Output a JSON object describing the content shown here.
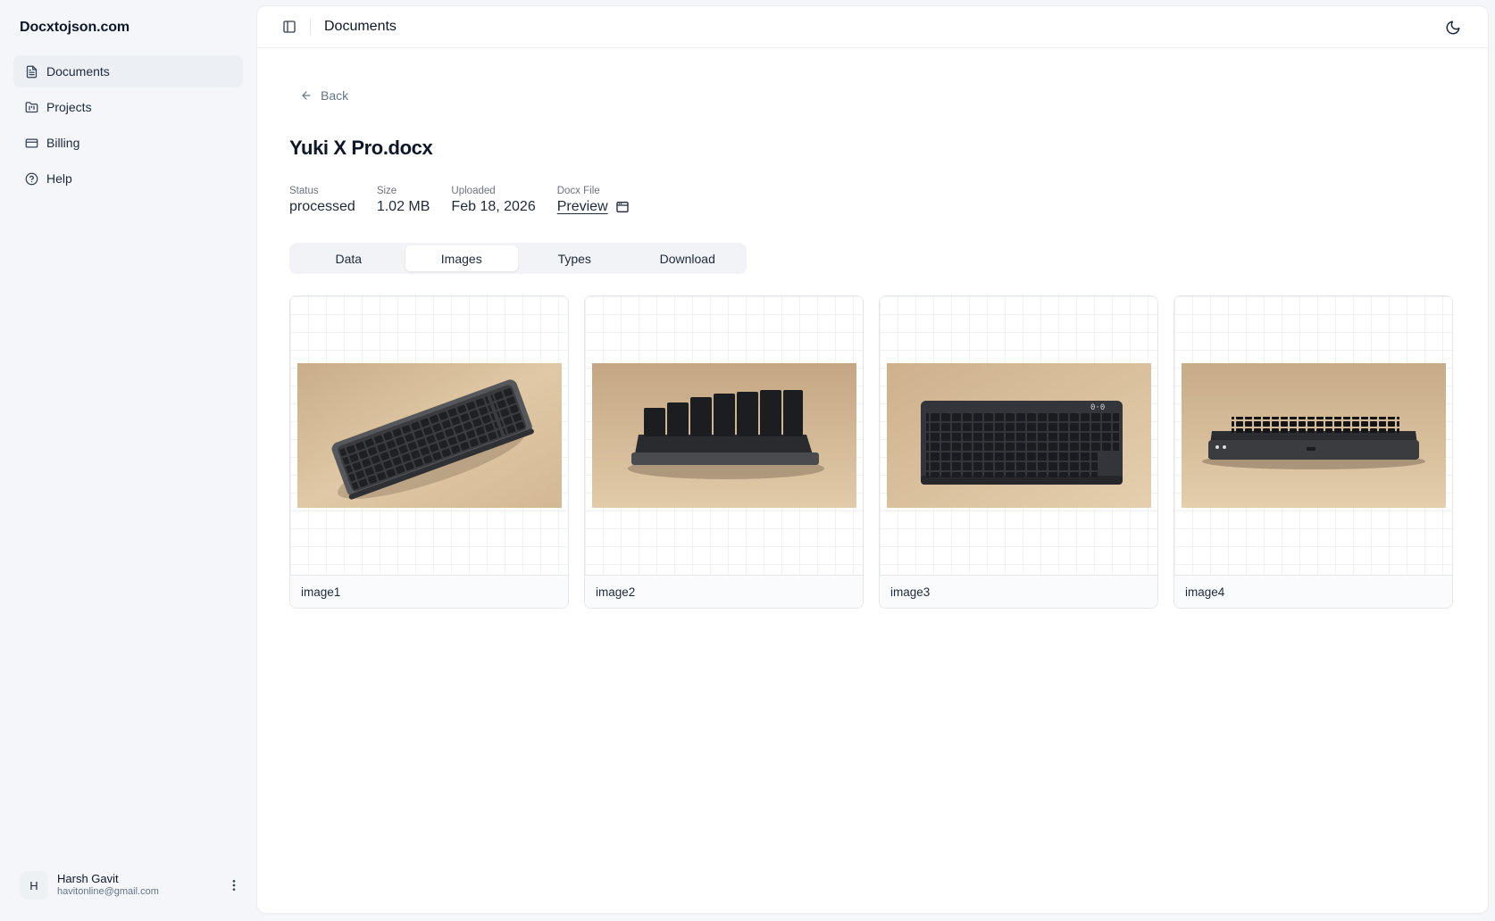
{
  "app": {
    "brand": "Docxtojson.com"
  },
  "sidebar": {
    "items": [
      {
        "label": "Documents",
        "icon": "document-icon",
        "active": true
      },
      {
        "label": "Projects",
        "icon": "folder-icon",
        "active": false
      },
      {
        "label": "Billing",
        "icon": "credit-card-icon",
        "active": false
      },
      {
        "label": "Help",
        "icon": "help-circle-icon",
        "active": false
      }
    ]
  },
  "user": {
    "initial": "H",
    "name": "Harsh Gavit",
    "email": "havitonline@gmail.com"
  },
  "header": {
    "title": "Documents"
  },
  "page": {
    "back_label": "Back",
    "title": "Yuki X Pro.docx",
    "meta": {
      "status_label": "Status",
      "status_value": "processed",
      "size_label": "Size",
      "size_value": "1.02 MB",
      "uploaded_label": "Uploaded",
      "uploaded_value": "Feb 18, 2026",
      "docx_label": "Docx File",
      "docx_value": "Preview"
    },
    "tabs": [
      {
        "label": "Data",
        "active": false
      },
      {
        "label": "Images",
        "active": true
      },
      {
        "label": "Types",
        "active": false
      },
      {
        "label": "Download",
        "active": false
      }
    ],
    "images": [
      {
        "name": "image1"
      },
      {
        "name": "image2"
      },
      {
        "name": "image3"
      },
      {
        "name": "image4"
      }
    ]
  },
  "colors": {
    "background": "#f4f6f9",
    "panel": "#ffffff",
    "text": "#0f172a",
    "muted": "#64748b",
    "photo_backdrop": "#dcc3a1"
  }
}
